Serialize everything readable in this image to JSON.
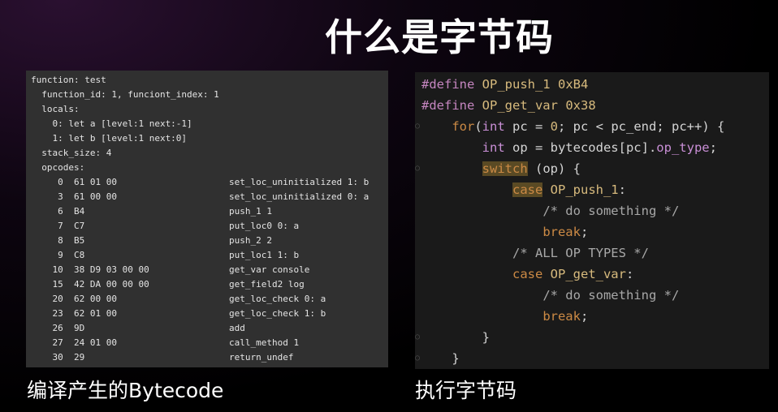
{
  "title": "什么是字节码",
  "left_caption": "编译产生的Bytecode",
  "right_caption": "执行字节码",
  "bytecode_dump": {
    "header": [
      "function: test",
      "  function_id: 1, funciont_index: 1",
      "  locals:",
      "    0: let a [level:1 next:-1]",
      "    1: let b [level:1 next:0]",
      "  stack_size: 4",
      "  opcodes:"
    ],
    "opcodes": [
      {
        "bytes": "     0  61 01 00",
        "instr": "set_loc_uninitialized 1: b"
      },
      {
        "bytes": "     3  61 00 00",
        "instr": "set_loc_uninitialized 0: a"
      },
      {
        "bytes": "     6  B4",
        "instr": "push_1 1"
      },
      {
        "bytes": "     7  C7",
        "instr": "put_loc0 0: a"
      },
      {
        "bytes": "     8  B5",
        "instr": "push_2 2"
      },
      {
        "bytes": "     9  C8",
        "instr": "put_loc1 1: b"
      },
      {
        "bytes": "    10  38 D9 03 00 00",
        "instr": "get_var console"
      },
      {
        "bytes": "    15  42 DA 00 00 00",
        "instr": "get_field2 log"
      },
      {
        "bytes": "    20  62 00 00",
        "instr": "get_loc_check 0: a"
      },
      {
        "bytes": "    23  62 01 00",
        "instr": "get_loc_check 1: b"
      },
      {
        "bytes": "    26  9D",
        "instr": "add"
      },
      {
        "bytes": "    27  24 01 00",
        "instr": "call_method 1"
      },
      {
        "bytes": "    30  29",
        "instr": "return_undef"
      }
    ]
  },
  "code": [
    {
      "fold": false,
      "tokens": [
        [
          "pp",
          "#define "
        ],
        [
          "macro",
          "OP_push_1"
        ],
        [
          "plain",
          " "
        ],
        [
          "num",
          "0xB4"
        ]
      ]
    },
    {
      "fold": false,
      "tokens": [
        [
          "pp",
          "#define "
        ],
        [
          "macro",
          "OP_get_var"
        ],
        [
          "plain",
          " "
        ],
        [
          "num",
          "0x38"
        ]
      ]
    },
    {
      "fold": true,
      "tokens": [
        [
          "plain",
          "    "
        ],
        [
          "kw",
          "for"
        ],
        [
          "plain",
          "("
        ],
        [
          "type",
          "int"
        ],
        [
          "plain",
          " pc = "
        ],
        [
          "num",
          "0"
        ],
        [
          "plain",
          "; pc < pc_end; pc++) {"
        ]
      ]
    },
    {
      "fold": false,
      "tokens": [
        [
          "plain",
          "        "
        ],
        [
          "type",
          "int"
        ],
        [
          "plain",
          " op = bytecodes[pc]."
        ],
        [
          "field",
          "op_type"
        ],
        [
          "plain",
          ";"
        ]
      ]
    },
    {
      "fold": true,
      "tokens": [
        [
          "plain",
          "        "
        ],
        [
          "kwhl",
          "switch"
        ],
        [
          "plain",
          " (op) {"
        ]
      ]
    },
    {
      "fold": false,
      "tokens": [
        [
          "plain",
          "            "
        ],
        [
          "kwhl",
          "case"
        ],
        [
          "plain",
          " "
        ],
        [
          "macro",
          "OP_push_1"
        ],
        [
          "plain",
          ":"
        ]
      ]
    },
    {
      "fold": false,
      "tokens": [
        [
          "plain",
          "                "
        ],
        [
          "comment",
          "/* do something */"
        ]
      ]
    },
    {
      "fold": false,
      "tokens": [
        [
          "plain",
          "                "
        ],
        [
          "kw",
          "break"
        ],
        [
          "plain",
          ";"
        ]
      ]
    },
    {
      "fold": false,
      "tokens": [
        [
          "plain",
          "            "
        ],
        [
          "comment",
          "/* ALL OP TYPES */"
        ]
      ]
    },
    {
      "fold": false,
      "tokens": [
        [
          "plain",
          "            "
        ],
        [
          "kw",
          "case"
        ],
        [
          "plain",
          " "
        ],
        [
          "macro",
          "OP_get_var"
        ],
        [
          "plain",
          ":"
        ]
      ]
    },
    {
      "fold": false,
      "tokens": [
        [
          "plain",
          "                "
        ],
        [
          "comment",
          "/* do something */"
        ]
      ]
    },
    {
      "fold": false,
      "tokens": [
        [
          "plain",
          "                "
        ],
        [
          "kw",
          "break"
        ],
        [
          "plain",
          ";"
        ]
      ]
    },
    {
      "fold": true,
      "tokens": [
        [
          "plain",
          "        }"
        ]
      ]
    },
    {
      "fold": true,
      "tokens": [
        [
          "plain",
          "    }"
        ]
      ]
    }
  ],
  "colors": {
    "preprocessor": "#c586c0",
    "macro": "#d7ba7d",
    "keyword": "#cc8a45",
    "type": "#c98fd6",
    "highlight": "#5a4a24"
  }
}
